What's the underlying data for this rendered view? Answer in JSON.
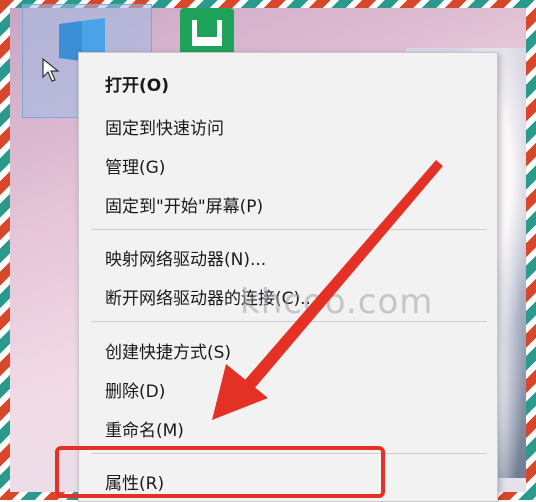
{
  "context_menu": {
    "items": [
      {
        "label": "打开(O)",
        "bold": true
      },
      {
        "label": "固定到快速访问"
      },
      {
        "label": "管理(G)"
      },
      {
        "label": "固定到\"开始\"屏幕(P)"
      },
      {
        "label": "映射网络驱动器(N)..."
      },
      {
        "label": "断开网络驱动器的连接(C)..."
      },
      {
        "label": "创建快捷方式(S)"
      },
      {
        "label": "删除(D)"
      },
      {
        "label": "重命名(M)"
      },
      {
        "label": "属性(R)"
      }
    ]
  },
  "watermark": "khcoo.com",
  "colors": {
    "highlight": "#e53125",
    "arrow": "#e53125",
    "menu_bg": "#f2f2f2"
  },
  "icons": [
    "this-pc-icon",
    "green-app-icon",
    "mouse-cursor-icon"
  ]
}
